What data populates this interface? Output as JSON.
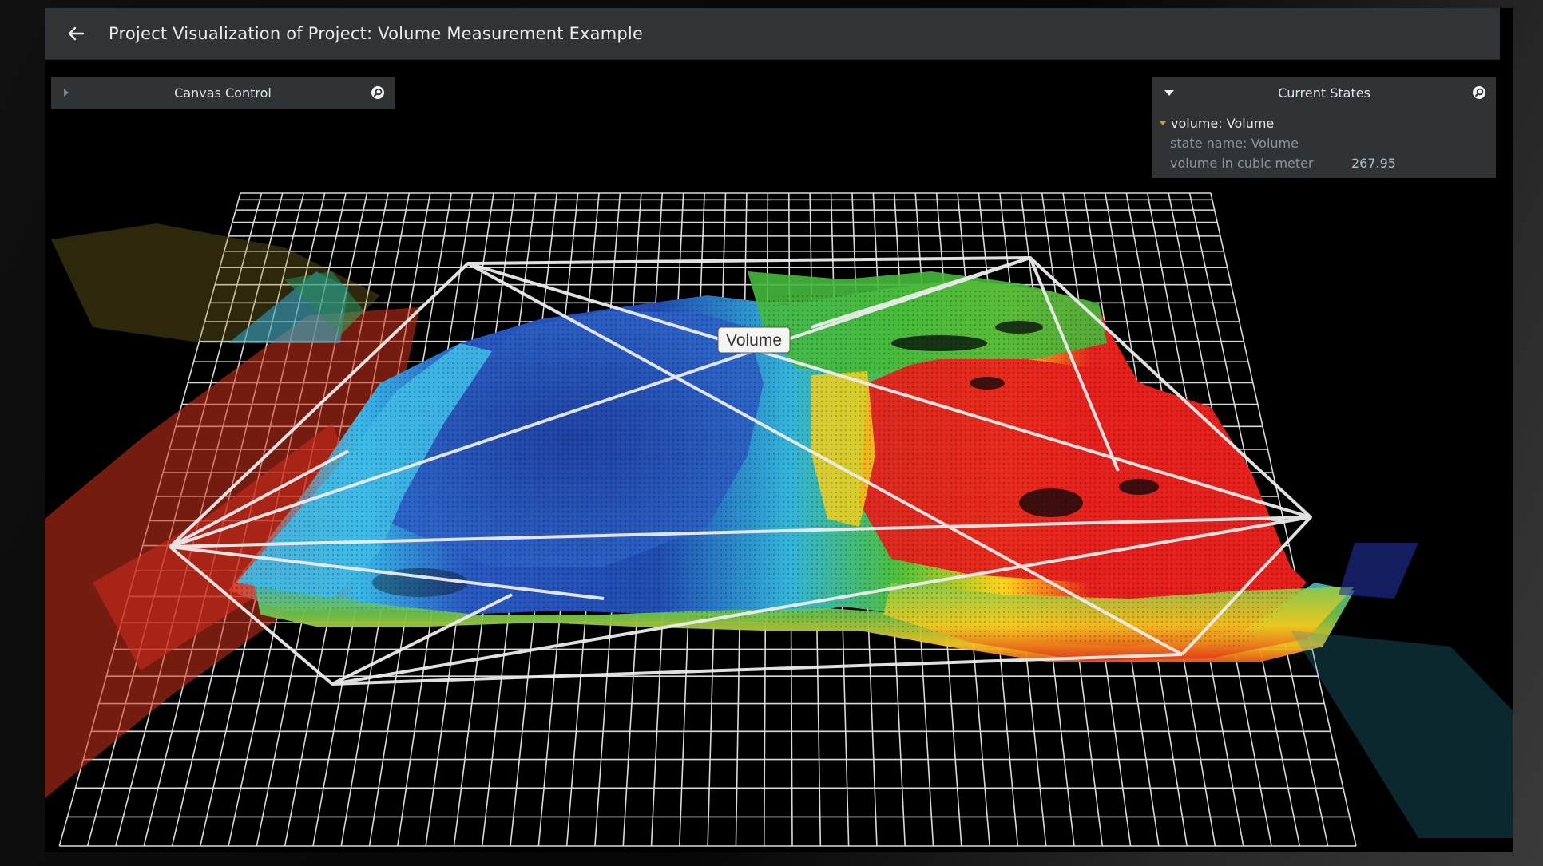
{
  "header": {
    "title": "Project Visualization of Project: Volume Measurement Example"
  },
  "canvas_control": {
    "title": "Canvas Control"
  },
  "current_states": {
    "title": "Current States",
    "state": {
      "label": "volume: Volume",
      "state_name": "state name: Volume",
      "metric_label": "volume in cubic meter",
      "metric_value": "267.95"
    }
  },
  "scene": {
    "volume_label": "Volume"
  },
  "icons": {
    "back": "arrow-left-icon",
    "expand": "caret-right-icon",
    "collapse": "caret-down-icon",
    "search": "magnifier-icon"
  },
  "colors": {
    "toolbar": "#303437",
    "panel": "#2f3336",
    "accent": "#c8a24a",
    "grid": "#ffffff"
  }
}
